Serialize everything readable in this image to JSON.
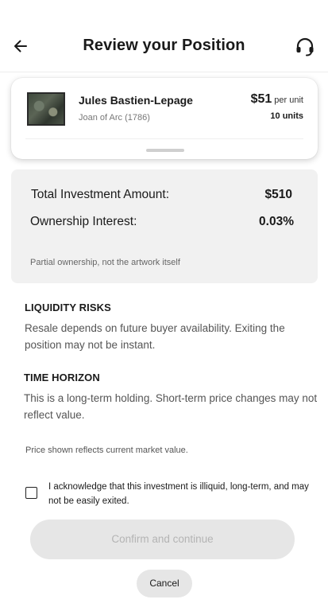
{
  "header": {
    "back_icon": "arrow-left-icon",
    "title": "Review your Position",
    "support_icon": "headset-icon"
  },
  "artwork": {
    "thumbnail": "artwork-thumbnail",
    "artist": "Jules Bastien-Lepage",
    "title": "Joan of Arc (1786)",
    "price": "$51",
    "per_unit_label": "per unit",
    "units": "10 units"
  },
  "summary": {
    "total_label": "Total Investment Amount:",
    "total_value": "$510",
    "ownership_label": "Ownership Interest:",
    "ownership_value": "0.03%",
    "note": "Partial ownership, not the artwork itself"
  },
  "liquidity": {
    "heading": "LIQUIDITY RISKS",
    "body": "Resale depends on future buyer availability. Exiting the position may not be instant."
  },
  "time_horizon": {
    "heading": "TIME HORIZON",
    "body": "This is a long-term holding. Short-term price changes may not reflect value."
  },
  "price_note": "Price shown reflects current market value.",
  "acknowledgement": {
    "checked": false,
    "text": "I acknowledge that this investment is illiquid, long-term, and may not be easily exited."
  },
  "actions": {
    "confirm_label": "Confirm and continue",
    "cancel_label": "Cancel"
  },
  "colors": {
    "summary_bg": "#f1f1f1",
    "disabled_button_bg": "#e6e6e6",
    "disabled_button_text": "#b4b4b4"
  }
}
